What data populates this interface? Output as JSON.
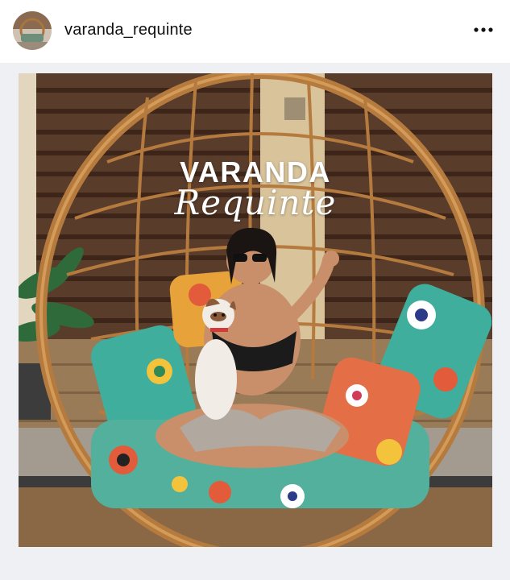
{
  "header": {
    "username": "varanda_requinte",
    "avatar_icon": "profile-avatar",
    "more_icon": "more-horizontal-icon"
  },
  "post": {
    "image_title": "VARANDA",
    "image_subtitle": "Requinte",
    "scene": "woman with small dog seated in hanging rattan egg chair with floral cushions"
  },
  "colors": {
    "background": "#eef0f3",
    "header_bg": "#ffffff",
    "text": "#111111",
    "rattan": "#b57a3e"
  }
}
